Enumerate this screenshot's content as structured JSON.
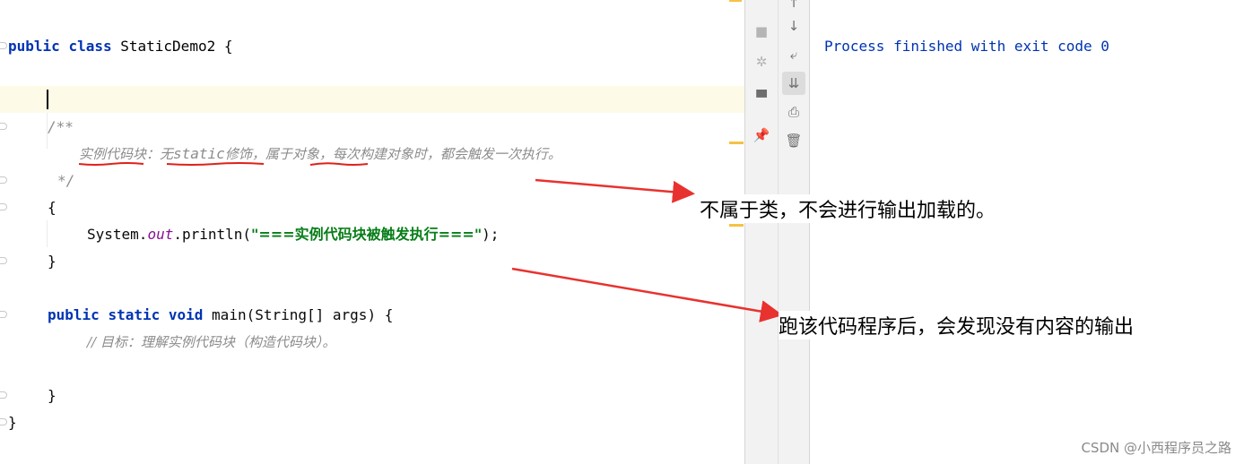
{
  "editor": {
    "line_class_decl": {
      "kw1": "public",
      "kw2": "class",
      "name": "StaticDemo2",
      "brace": "{"
    },
    "doc_open": "/**",
    "doc_text": {
      "part1": "实例代码块：无",
      "static": "static",
      "part2": "修饰，属于对象，每次构建对象时，都会触发一次执行。"
    },
    "doc_close": "*/",
    "block_open": "{",
    "println": {
      "prefix": "System.",
      "field": "out",
      "call": ".println(",
      "str": "\"===实例代码块被触发执行===\"",
      "suffix": ");"
    },
    "block_close": "}",
    "main_decl": {
      "kw1": "public",
      "kw2": "static",
      "kw3": "void",
      "rest": "main(String[] args) {"
    },
    "line_comment": "// 目标：理解实例代码块（构造代码块）。",
    "main_close": "}",
    "class_close": "}"
  },
  "console": {
    "output": "Process finished with exit code 0"
  },
  "toolbar": {
    "col1": [
      "stop-icon",
      "debug-icon",
      "layout-icon",
      "pin-icon"
    ],
    "col2": [
      "scroll-down-icon",
      "soft-wrap-icon",
      "scroll-to-end-icon",
      "print-icon",
      "trash-icon"
    ]
  },
  "annotations": {
    "note1": "不属于类，不会进行输出加载的。",
    "note2": "跑该代码程序后，会发现没有内容的输出"
  },
  "watermark": "CSDN @小西程序员之路",
  "colors": {
    "arrow": "#e8322f",
    "scribble": "#e0201c",
    "keyword": "#0033b3",
    "string": "#067d17"
  }
}
